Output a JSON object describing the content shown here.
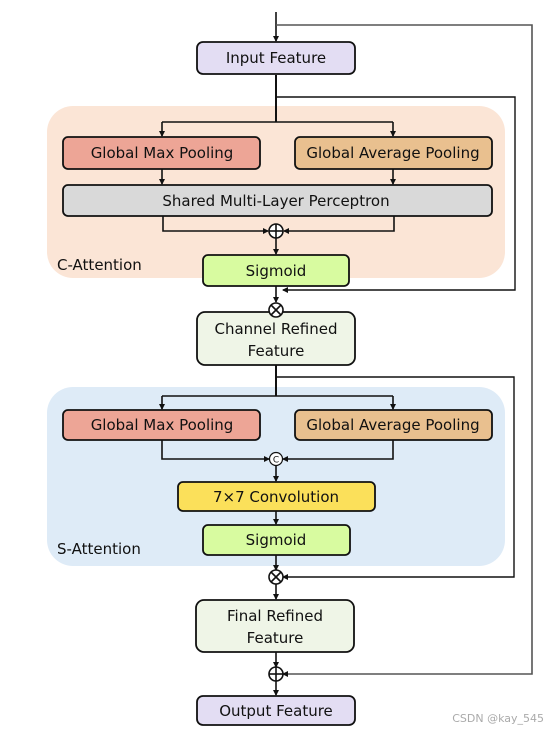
{
  "nodes": {
    "input": "Input Feature",
    "c_max_pool": "Global Max Pooling",
    "c_avg_pool": "Global Average Pooling",
    "mlp": "Shared Multi-Layer Perceptron",
    "c_sigmoid": "Sigmoid",
    "channel_refined_line1": "Channel Refined",
    "channel_refined_line2": "Feature",
    "s_max_pool": "Global Max Pooling",
    "s_avg_pool": "Global Average Pooling",
    "conv": "7×7 Convolution",
    "s_sigmoid": "Sigmoid",
    "final_refined_line1": "Final Refined",
    "final_refined_line2": "Feature",
    "output": "Output Feature"
  },
  "groups": {
    "c_attention": "C-Attention",
    "s_attention": "S-Attention"
  },
  "operators": {
    "add": "⊕",
    "multiply": "⊗",
    "concat": "C"
  },
  "watermark": "CSDN @kay_545",
  "colors": {
    "c_attention_bg": "#fbe5d6",
    "s_attention_bg": "#deebf7",
    "max_pool": "#eda596",
    "avg_pool": "#e9c08f",
    "mlp": "#d9d9d9",
    "sigmoid": "#d8fba0",
    "feature": "#eff5e7",
    "io": "#e3ddf3",
    "conv": "#fbe05a"
  }
}
